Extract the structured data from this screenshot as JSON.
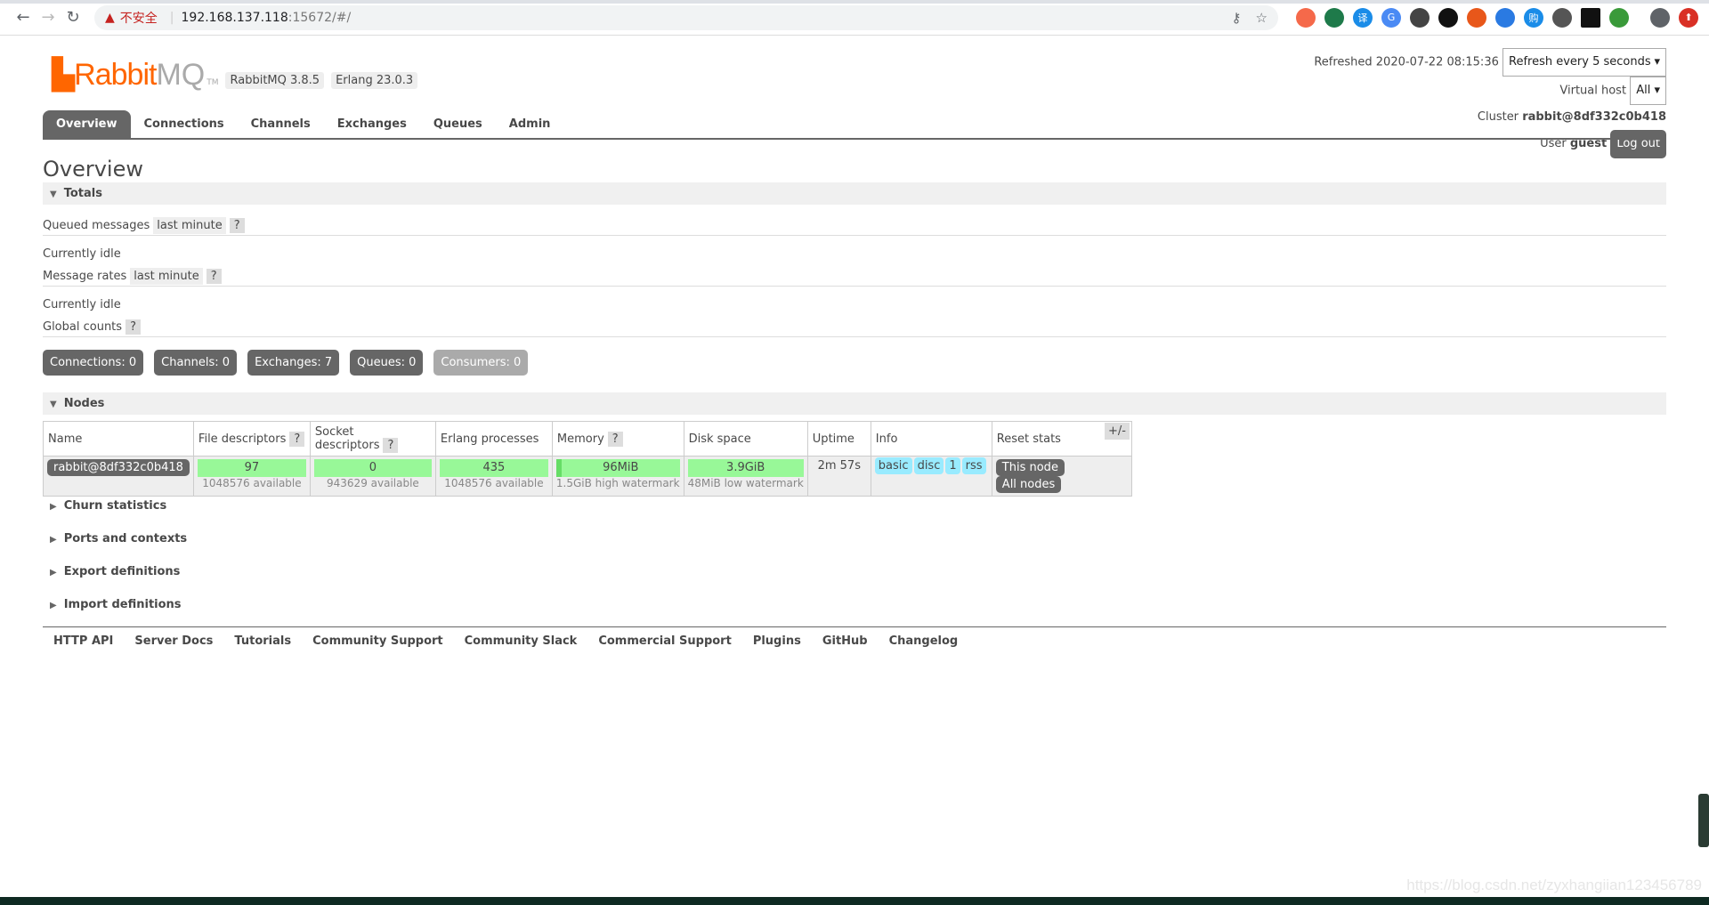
{
  "browser": {
    "security_label": "不安全",
    "url_host": "192.168.137.118",
    "url_rest": ":15672/#/"
  },
  "header": {
    "logo": "RabbitMQ",
    "logo_tm": "TM",
    "version": "RabbitMQ 3.8.5",
    "erlang": "Erlang 23.0.3",
    "refreshed": "Refreshed 2020-07-22 08:15:36",
    "refresh_select": "Refresh every 5 seconds",
    "vhost_label": "Virtual host",
    "vhost_value": "All",
    "cluster_label": "Cluster",
    "cluster_name": "rabbit@8df332c0b418",
    "user_label": "User",
    "user_name": "guest",
    "logout": "Log out"
  },
  "tabs": [
    "Overview",
    "Connections",
    "Channels",
    "Exchanges",
    "Queues",
    "Admin"
  ],
  "title": "Overview",
  "totals": {
    "heading": "Totals",
    "queued_label": "Queued messages",
    "queued_range": "last minute",
    "help": "?",
    "idle1": "Currently idle",
    "rates_label": "Message rates",
    "rates_range": "last minute",
    "idle2": "Currently idle",
    "global_label": "Global counts"
  },
  "counts": [
    "Connections: 0",
    "Channels: 0",
    "Exchanges: 7",
    "Queues: 0",
    "Consumers: 0"
  ],
  "nodes": {
    "heading": "Nodes",
    "plus_minus": "+/-",
    "columns": [
      "Name",
      "File descriptors",
      "Socket descriptors",
      "Erlang processes",
      "Memory",
      "Disk space",
      "Uptime",
      "Info",
      "Reset stats"
    ],
    "row": {
      "name": "rabbit@8df332c0b418",
      "fd": "97",
      "fd_sub": "1048576 available",
      "sd": "0",
      "sd_sub": "943629 available",
      "ep": "435",
      "ep_sub": "1048576 available",
      "mem": "96MiB",
      "mem_sub": "1.5GiB high watermark",
      "disk": "3.9GiB",
      "disk_sub": "48MiB low watermark",
      "uptime": "2m 57s",
      "info": [
        "basic",
        "disc",
        "1",
        "rss"
      ],
      "reset_this": "This node",
      "reset_all": "All nodes"
    }
  },
  "sections": [
    "Churn statistics",
    "Ports and contexts",
    "Export definitions",
    "Import definitions"
  ],
  "footer": [
    "HTTP API",
    "Server Docs",
    "Tutorials",
    "Community Support",
    "Community Slack",
    "Commercial Support",
    "Plugins",
    "GitHub",
    "Changelog"
  ],
  "watermark": "https://blog.csdn.net/zyxhangiian123456789"
}
